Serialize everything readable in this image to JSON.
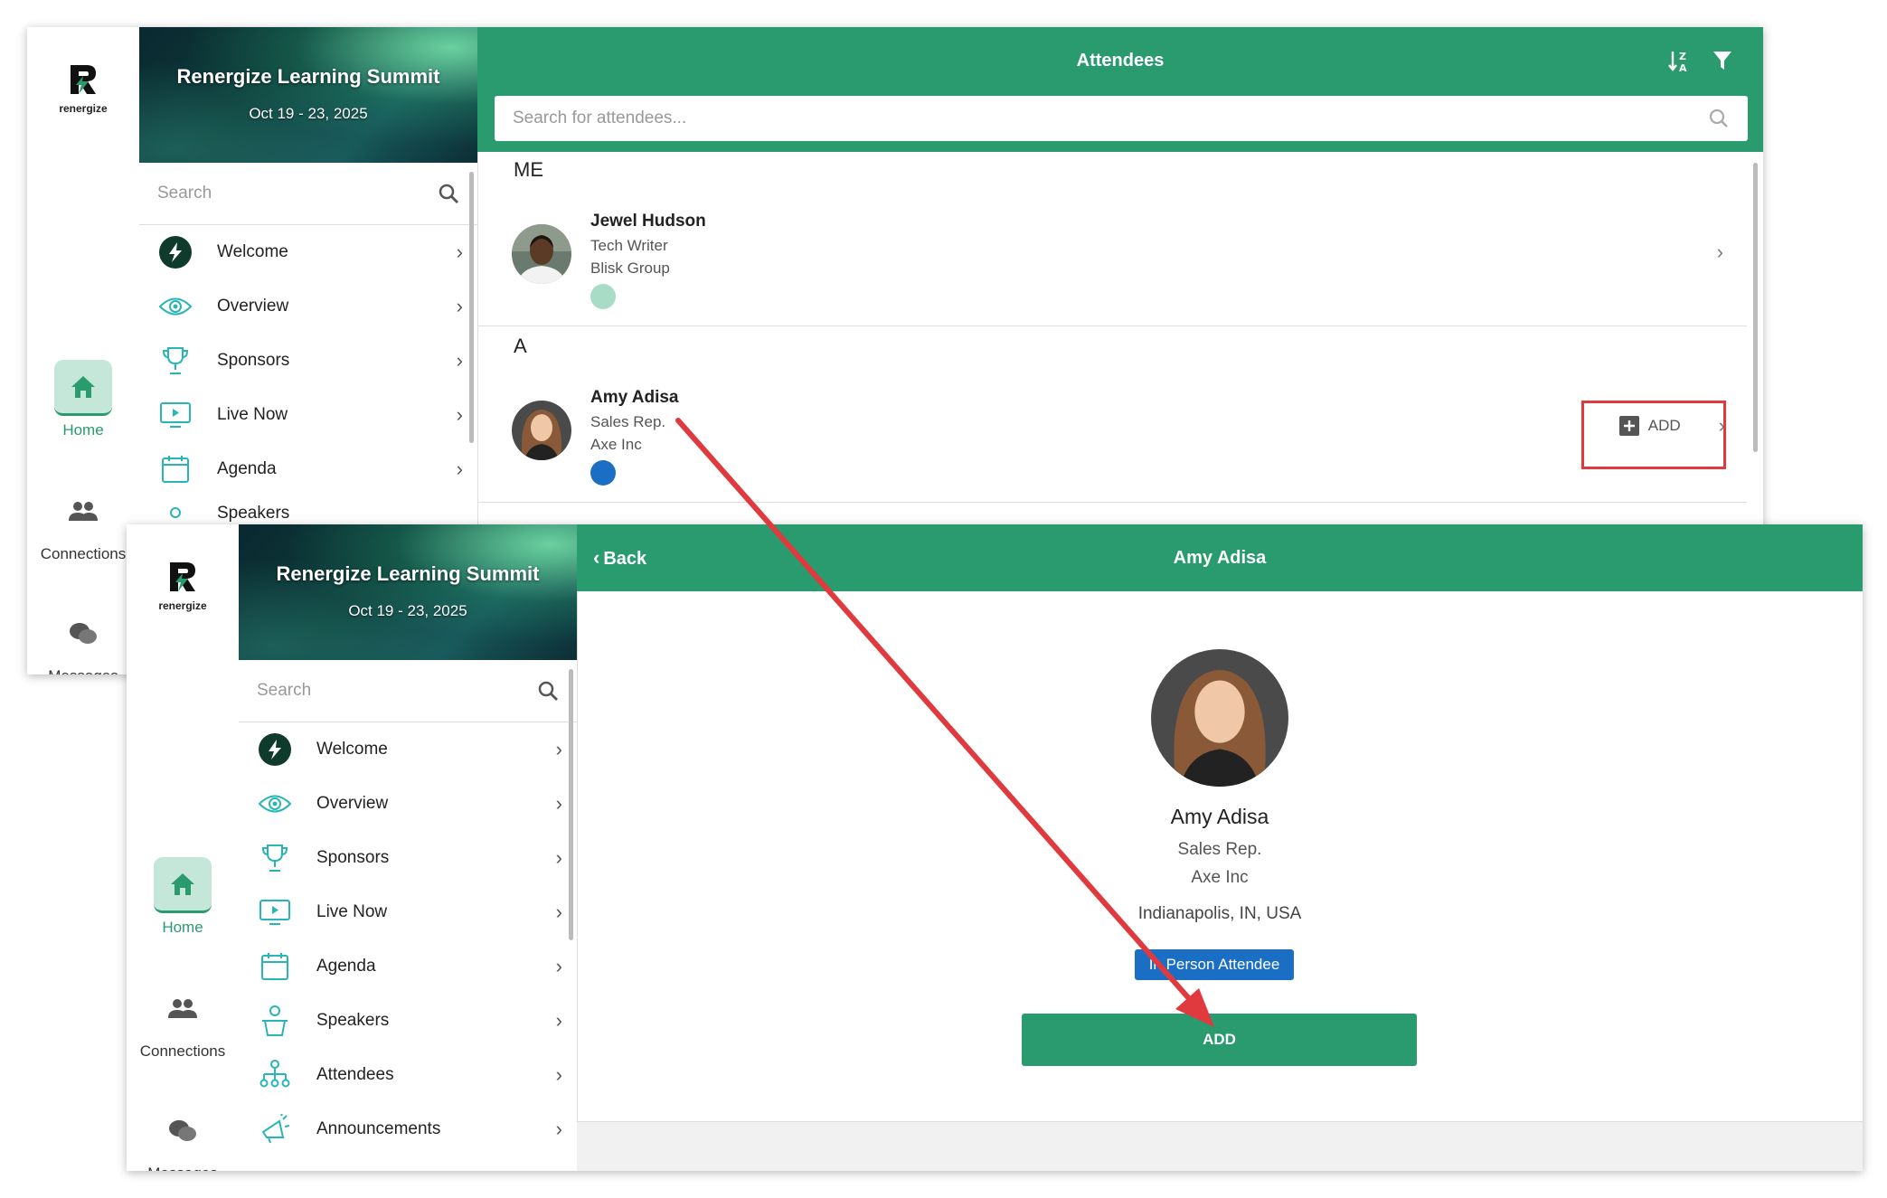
{
  "app": {
    "logo_text": "renergize"
  },
  "event": {
    "title": "Renergize Learning Summit",
    "dates": "Oct 19 - 23, 2025"
  },
  "rail": {
    "home": "Home",
    "connections": "Connections",
    "messages": "Messages"
  },
  "sidebar": {
    "search_placeholder": "Search",
    "items": [
      {
        "label": "Welcome"
      },
      {
        "label": "Overview"
      },
      {
        "label": "Sponsors"
      },
      {
        "label": "Live Now"
      },
      {
        "label": "Agenda"
      },
      {
        "label": "Speakers"
      },
      {
        "label": "Attendees"
      },
      {
        "label": "Announcements"
      }
    ]
  },
  "attendees": {
    "title": "Attendees",
    "search_placeholder": "Search for attendees...",
    "section_me": "ME",
    "section_a": "A",
    "me": {
      "name": "Jewel Hudson",
      "title": "Tech Writer",
      "company": "Blisk Group",
      "dot_color": "#a9dcc7"
    },
    "amy": {
      "name": "Amy Adisa",
      "title": "Sales Rep.",
      "company": "Axe Inc",
      "dot_color": "#1a6fc4",
      "add_label": "ADD"
    }
  },
  "detail": {
    "back_label": "Back",
    "title": "Amy Adisa",
    "name": "Amy Adisa",
    "job_title": "Sales Rep.",
    "company": "Axe Inc",
    "location": "Indianapolis, IN, USA",
    "badge": "In Person Attendee",
    "add_button": "ADD"
  },
  "colors": {
    "brand_green": "#2a9a6f",
    "highlight_red": "#e0393e",
    "badge_blue": "#1a6fc4"
  }
}
